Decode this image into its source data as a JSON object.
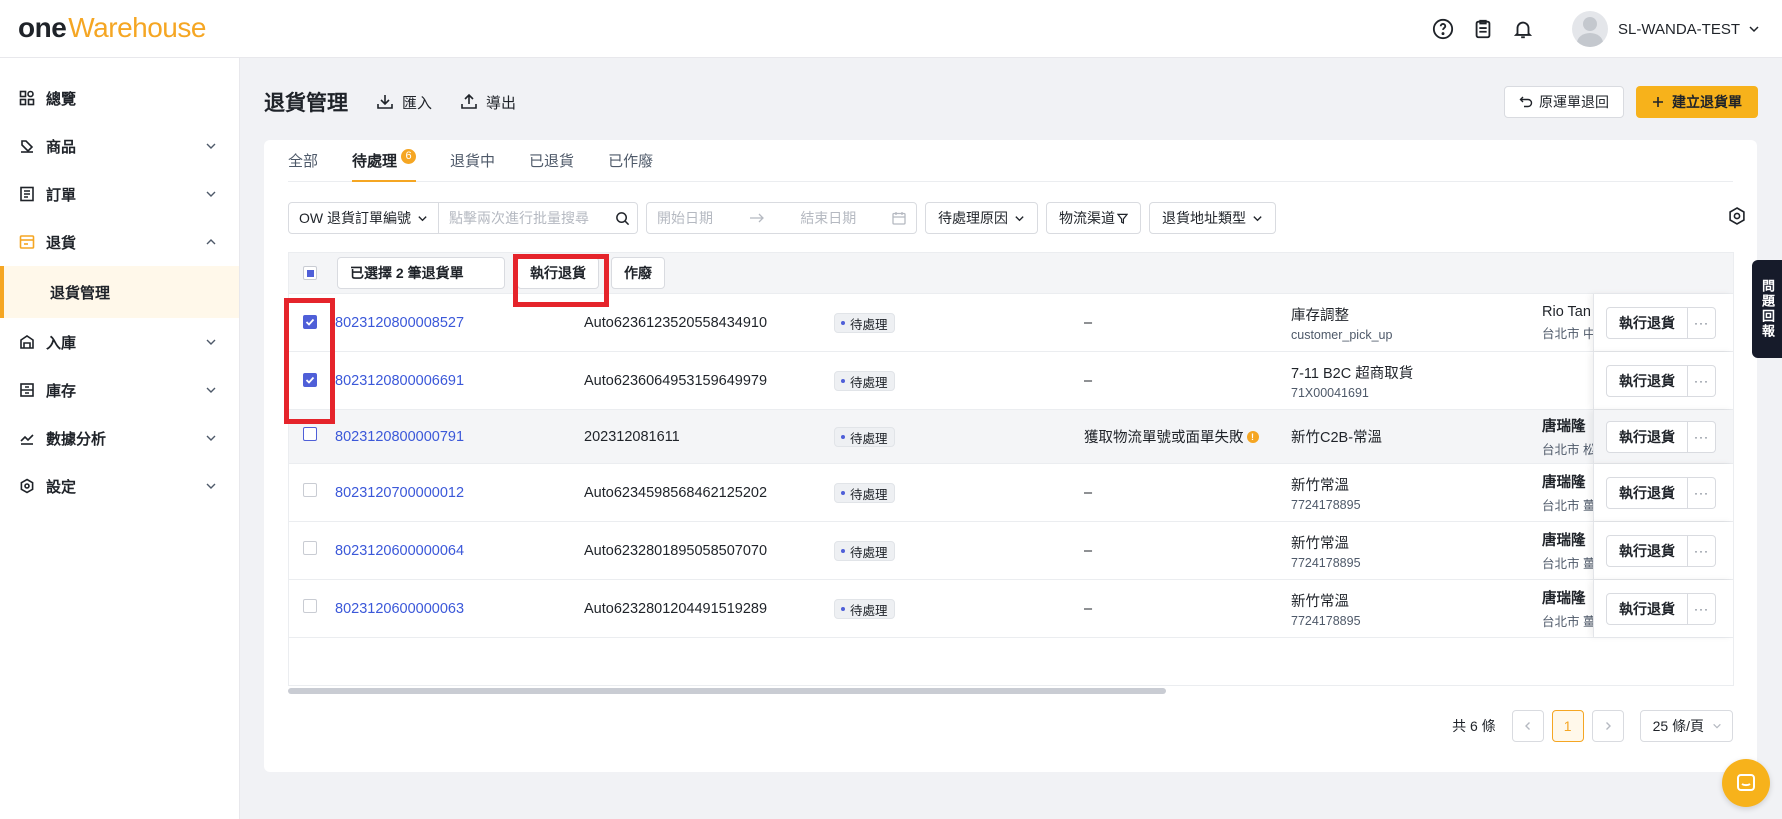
{
  "app": {
    "logo_one": "one",
    "logo_warehouse": "Warehouse"
  },
  "user": {
    "name": "SL-WANDA-TEST"
  },
  "sidebar": {
    "items": [
      {
        "label": "總覽",
        "icon": "dashboard-icon"
      },
      {
        "label": "商品",
        "icon": "product-icon"
      },
      {
        "label": "訂單",
        "icon": "order-icon"
      },
      {
        "label": "退貨",
        "icon": "return-icon"
      },
      {
        "label": "退貨管理"
      },
      {
        "label": "入庫",
        "icon": "inbound-icon"
      },
      {
        "label": "庫存",
        "icon": "inventory-icon"
      },
      {
        "label": "數據分析",
        "icon": "analytics-icon"
      },
      {
        "label": "設定",
        "icon": "settings-icon"
      }
    ]
  },
  "header": {
    "title": "退貨管理",
    "import_label": "匯入",
    "export_label": "導出",
    "original_return_label": "原運單退回",
    "create_label": "建立退貨單"
  },
  "tabs": [
    {
      "label": "全部"
    },
    {
      "label": "待處理",
      "count": "6"
    },
    {
      "label": "退貨中"
    },
    {
      "label": "已退貨"
    },
    {
      "label": "已作廢"
    }
  ],
  "filters": {
    "search_field": "OW 退貨訂單編號",
    "search_placeholder": "點擊兩次進行批量搜尋",
    "start_date": "開始日期",
    "end_date": "結束日期",
    "reason": "待處理原因",
    "channel": "物流渠道",
    "address_type": "退貨地址類型"
  },
  "bulk": {
    "selected_label": "已選擇 2 筆退貨單",
    "execute_label": "執行退貨",
    "void_label": "作廢"
  },
  "rows": [
    {
      "id": "8023120800008527",
      "ref": "Auto6236123520558434910",
      "status": "待處理",
      "error": "–",
      "channel": "庫存調整",
      "channel_sub": "customer_pick_up",
      "receiver": "Rio Tan",
      "receiver_sub": "台北市 中",
      "action": "執行退貨",
      "checked": true
    },
    {
      "id": "8023120800006691",
      "ref": "Auto6236064953159649979",
      "status": "待處理",
      "error": "–",
      "channel": "7-11 B2C 超商取貨",
      "channel_sub": "71X00041691",
      "receiver": "",
      "receiver_sub": "",
      "action": "執行退貨",
      "checked": true
    },
    {
      "id": "8023120800000791",
      "ref": "202312081611",
      "status": "待處理",
      "error": "獲取物流單號或面單失敗",
      "channel": "新竹C2B-常溫",
      "channel_sub": "",
      "receiver": "唐瑞隆",
      "receiver_sub": "台北市 松",
      "action": "執行退貨",
      "checked": false
    },
    {
      "id": "8023120700000012",
      "ref": "Auto6234598568462125202",
      "status": "待處理",
      "error": "–",
      "channel": "新竹常溫",
      "channel_sub": "7724178895",
      "receiver": "唐瑞隆",
      "receiver_sub": "台北市 薑",
      "action": "執行退貨",
      "checked": false
    },
    {
      "id": "8023120600000064",
      "ref": "Auto6232801895058507070",
      "status": "待處理",
      "error": "–",
      "channel": "新竹常溫",
      "channel_sub": "7724178895",
      "receiver": "唐瑞隆",
      "receiver_sub": "台北市 薑",
      "action": "執行退貨",
      "checked": false
    },
    {
      "id": "8023120600000063",
      "ref": "Auto6232801204491519289",
      "status": "待處理",
      "error": "–",
      "channel": "新竹常溫",
      "channel_sub": "7724178895",
      "receiver": "唐瑞隆",
      "receiver_sub": "台北市 薑",
      "action": "執行退貨",
      "checked": false
    }
  ],
  "pager": {
    "total": "共 6 條",
    "current": "1",
    "size": "25 條/頁"
  },
  "feedback": {
    "label": "問題回報"
  },
  "colors": {
    "accent": "#f5a623",
    "primary_button": "#f7b21b",
    "link": "#3b58d9",
    "highlight": "#e5242b"
  }
}
